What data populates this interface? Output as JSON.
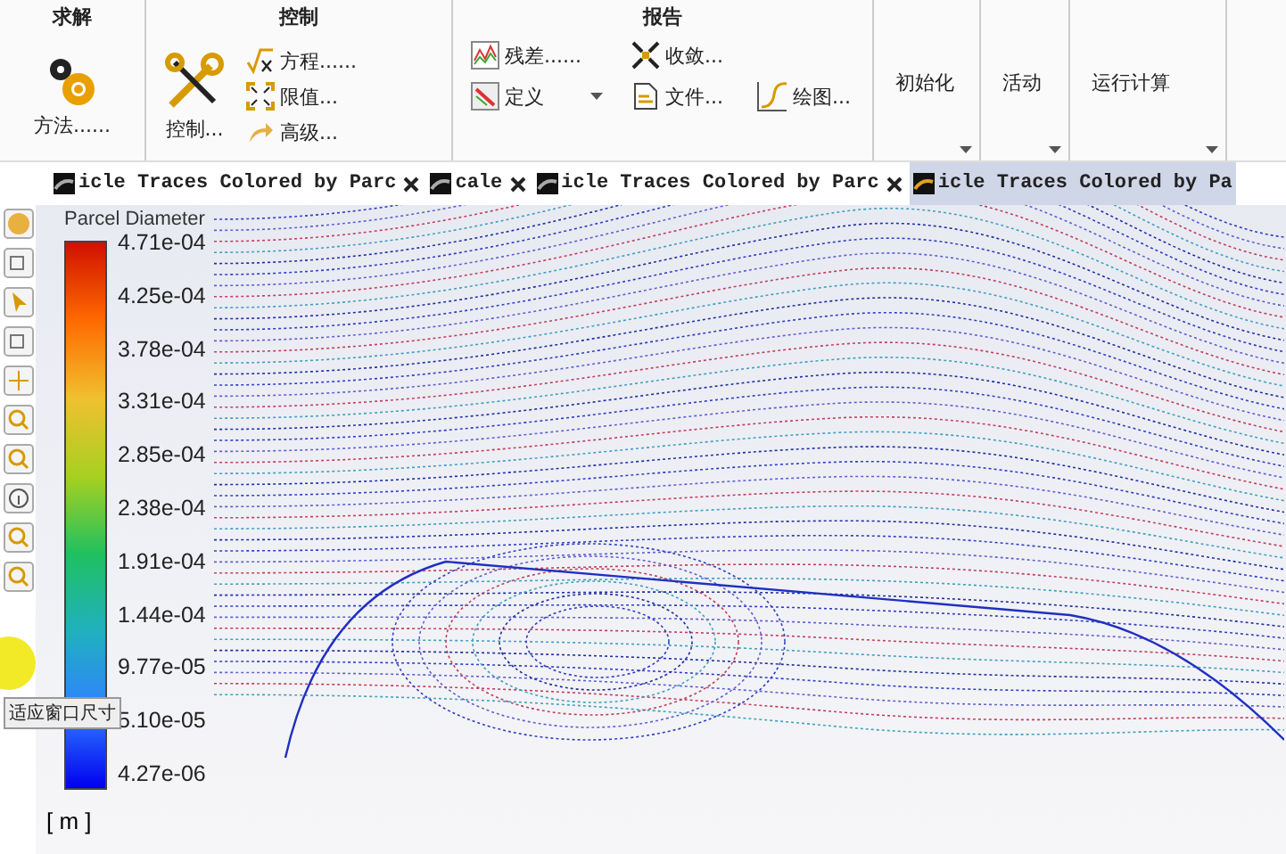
{
  "ribbon": {
    "groups": [
      {
        "kind": "solve",
        "title": "求解",
        "items": [
          {
            "label": "方法......"
          }
        ]
      },
      {
        "kind": "control",
        "title": "控制",
        "items": [
          {
            "label": "控制..."
          },
          {
            "label": "方程......"
          },
          {
            "label": "限值..."
          },
          {
            "label": "高级..."
          }
        ]
      },
      {
        "kind": "report",
        "title": "报告",
        "items": [
          {
            "label": "残差......"
          },
          {
            "label": "收敛..."
          },
          {
            "label": "定义"
          },
          {
            "label": "文件..."
          },
          {
            "label": "绘图..."
          }
        ]
      },
      {
        "kind": "simple",
        "title": "初始化"
      },
      {
        "kind": "simple",
        "title": "活动"
      },
      {
        "kind": "simple",
        "title": "运行计算"
      }
    ]
  },
  "tabs": [
    {
      "label": "icle Traces Colored by Parc",
      "selected": false
    },
    {
      "label": "cale",
      "selected": false
    },
    {
      "label": "icle Traces Colored by Parc",
      "selected": false
    },
    {
      "label": "icle Traces Colored by Pa",
      "selected": true
    }
  ],
  "toolbar": {
    "tooltip": "适应窗口尺寸"
  },
  "legend": {
    "title": "Parcel Diameter",
    "labels": [
      "4.71e-04",
      "4.25e-04",
      "3.78e-04",
      "3.31e-04",
      "2.85e-04",
      "2.38e-04",
      "1.91e-04",
      "1.44e-04",
      "9.77e-05",
      "5.10e-05",
      "4.27e-06"
    ],
    "unit": "[ m ]"
  }
}
